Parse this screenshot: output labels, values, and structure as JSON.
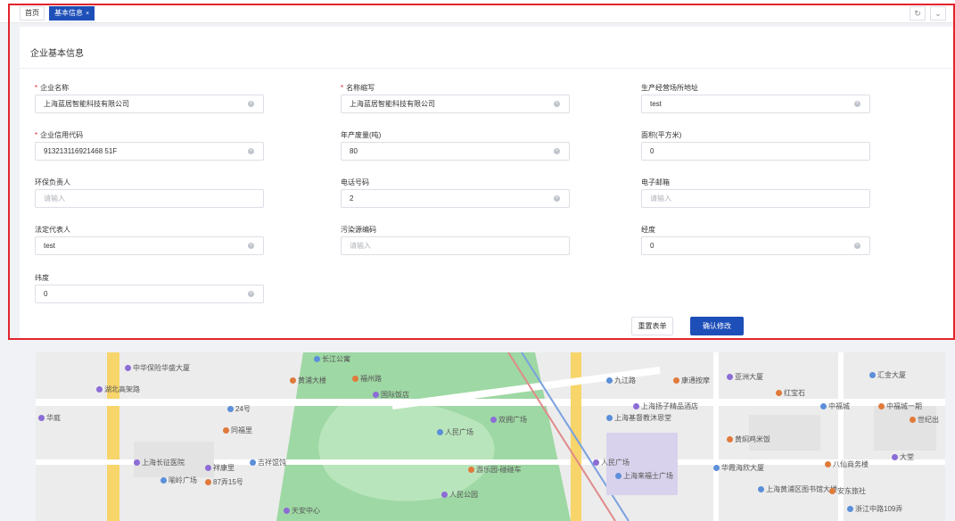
{
  "tabs": {
    "home": "首页",
    "active": "基本信息",
    "close": "×",
    "refresh": "↻",
    "more": "⌄"
  },
  "panel": {
    "title": "企业基本信息"
  },
  "fields": {
    "company_name": {
      "label": "企业名称",
      "value": "上海蓝居智能科技有限公司",
      "required": "*"
    },
    "short_name": {
      "label": "名称缩写",
      "value": "上海蓝居智能科技有限公司",
      "required": "*"
    },
    "address": {
      "label": "生产经营场所地址",
      "value": "test"
    },
    "credit_code": {
      "label": "企业信用代码",
      "value": "913213116921468 51F",
      "required": "*"
    },
    "annual_output": {
      "label": "年产废量(吨)",
      "value": "80"
    },
    "area": {
      "label": "面积(平方米)",
      "value": "0"
    },
    "env_manager": {
      "label": "环保负责人",
      "placeholder": "请输入"
    },
    "phone": {
      "label": "电话号码",
      "value": "2"
    },
    "email": {
      "label": "电子邮箱",
      "placeholder": "请输入"
    },
    "legal_rep": {
      "label": "法定代表人",
      "value": "test"
    },
    "pollution_code": {
      "label": "污染源编码",
      "placeholder": "请输入"
    },
    "longitude": {
      "label": "经度",
      "value": "0"
    },
    "latitude": {
      "label": "纬度",
      "value": "0"
    }
  },
  "buttons": {
    "reset": "重置表单",
    "confirm": "确认修改"
  },
  "map": {
    "pois": [
      "中华保险华盛大厦",
      "长江公寓",
      "黄浦大楼",
      "国际饭店",
      "九江路",
      "康通按摩",
      "亚洲大厦",
      "汇金大厦",
      "红宝石",
      "上海扬子精品酒店",
      "上海基督教沐恩堂",
      "黄焖鸡米饭",
      "双拥广场",
      "人民广场",
      "世纪出",
      "上海长征医院",
      "吉祥馄饨",
      "游乐园-碰碰车",
      "人民广场",
      "华霞海欣大厦",
      "八仙商务楼",
      "大堂",
      "喻岭广场",
      "87弄15号",
      "人民公园",
      "上海黄浦区图书馆大楼",
      "安东旅社",
      "天安中心",
      "浙江中路109弄",
      "同福里",
      "祥康里",
      "24号",
      "福州路",
      "湖北高架路",
      "中福城",
      "中福城一期",
      "华庭",
      "上海来福士广场"
    ]
  },
  "colors": {
    "accent": "#1e4fb8",
    "required": "#e02020",
    "highlight_frame": "#e3242b"
  }
}
